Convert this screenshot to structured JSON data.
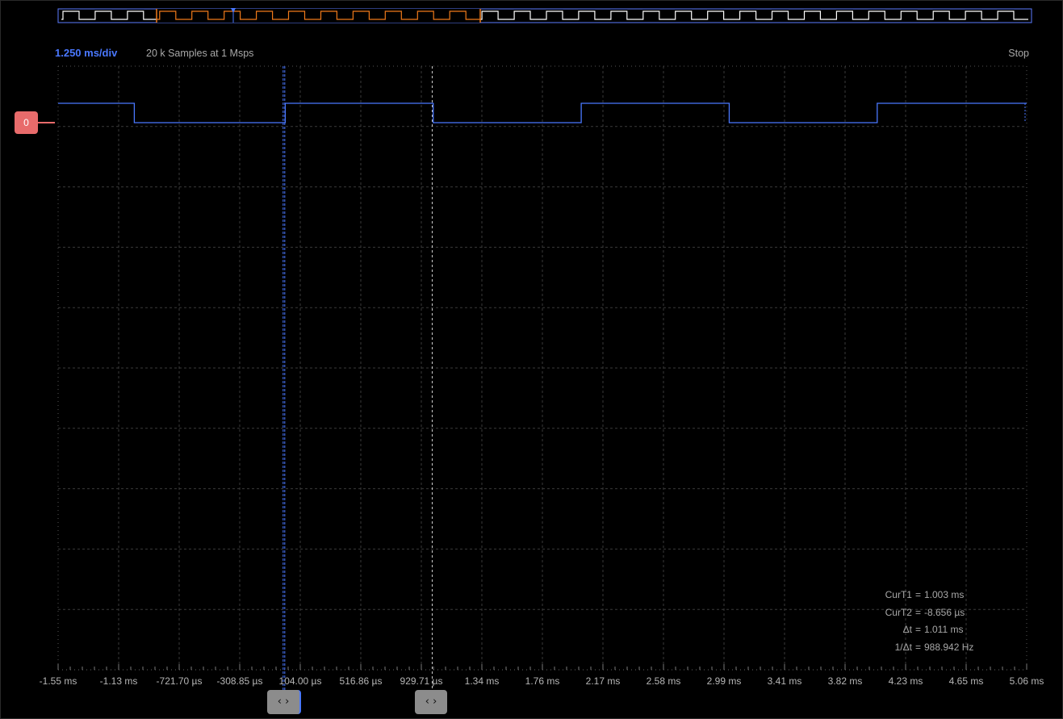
{
  "header": {
    "timebase": "1.250 ms/div",
    "samples": "20 k Samples at 1 Msps",
    "run_state": "Stop"
  },
  "channel": {
    "label": "0",
    "color": "#e86b6b",
    "trace_color": "#4a78ff"
  },
  "overview": {
    "trace_color": "#ffffff",
    "highlight_color": "#f07a1a",
    "pulses": 30
  },
  "x_axis": {
    "ticks": [
      "-1.55 ms",
      "-1.13 ms",
      "-721.70 µs",
      "-308.85 µs",
      "104.00 µs",
      "516.86 µs",
      "929.71 µs",
      "1.34 ms",
      "1.76 ms",
      "2.17 ms",
      "2.58 ms",
      "2.99 ms",
      "3.41 ms",
      "3.82 ms",
      "4.23 ms",
      "4.65 ms",
      "5.06 ms"
    ]
  },
  "cursors": {
    "rows": [
      {
        "label": "CurT1",
        "value": "1.003 ms"
      },
      {
        "label": "CurT2",
        "value": "-8.656 µs"
      },
      {
        "label": "Δt",
        "value": "1.011 ms"
      },
      {
        "label": "1/Δt",
        "value": "988.942 Hz"
      }
    ],
    "handle_glyph": "‹ ›",
    "t1_ms": 1.003,
    "t2_ms": -0.008656
  },
  "chart_data": {
    "type": "line",
    "x_unit": "ms",
    "xlim": [
      -1.55,
      5.06
    ],
    "y_levels": [
      "high",
      "low"
    ],
    "series": [
      {
        "transitions_ms": [
          -1.03,
          0.0,
          1.01,
          2.02,
          3.03,
          4.04
        ],
        "initial_level": 1
      }
    ]
  }
}
